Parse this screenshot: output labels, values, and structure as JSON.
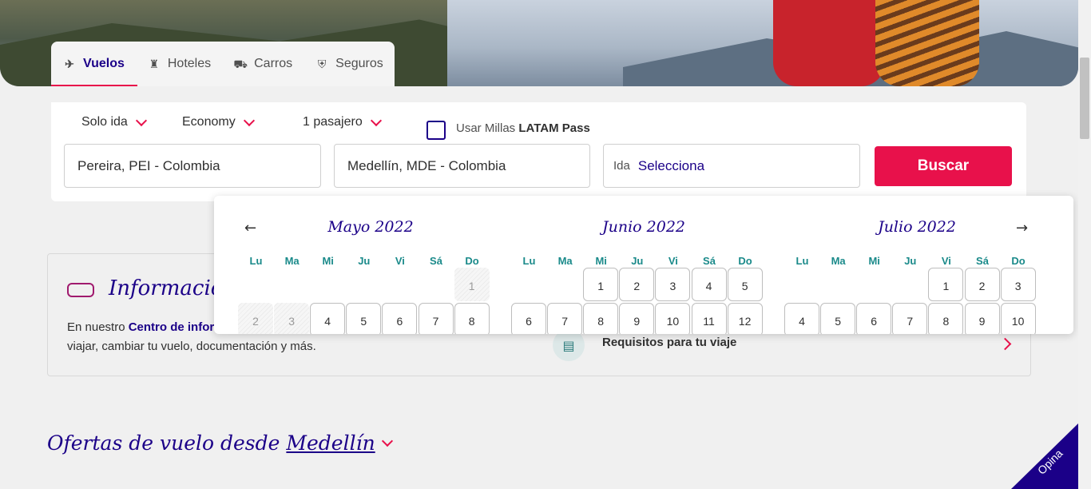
{
  "tabs": [
    {
      "label": "Vuelos",
      "icon": "plane-icon",
      "active": true
    },
    {
      "label": "Hoteles",
      "icon": "bellhop-icon",
      "active": false
    },
    {
      "label": "Carros",
      "icon": "car-icon",
      "active": false
    },
    {
      "label": "Seguros",
      "icon": "shield-icon",
      "active": false
    }
  ],
  "search": {
    "trip_type": "Solo ida",
    "cabin": "Economy",
    "passengers": "1 pasajero",
    "millas_prefix": "Usar Millas",
    "millas_brand": "LATAM Pass",
    "origin": "Pereira, PEI - Colombia",
    "destination": "Medellín, MDE - Colombia",
    "date_label": "Ida",
    "date_value": "Selecciona",
    "submit": "Buscar"
  },
  "calendar": {
    "prev_arrow": "←",
    "next_arrow": "→",
    "weekdays": [
      "Lu",
      "Ma",
      "Mi",
      "Ju",
      "Vi",
      "Sá",
      "Do"
    ],
    "months": [
      {
        "title": "Mayo 2022",
        "first_weekday_index": 6,
        "visible_days": [
          "1",
          "2",
          "3",
          "4",
          "5",
          "6",
          "7",
          "8"
        ],
        "past_days": [
          "1",
          "2",
          "3"
        ]
      },
      {
        "title": "Junio 2022",
        "first_weekday_index": 2,
        "visible_days": [
          "1",
          "2",
          "3",
          "4",
          "5",
          "6",
          "7",
          "8",
          "9",
          "10",
          "11",
          "12"
        ],
        "past_days": []
      },
      {
        "title": "Julio 2022",
        "first_weekday_index": 4,
        "visible_days": [
          "1",
          "2",
          "3",
          "4",
          "5",
          "6",
          "7",
          "8",
          "9",
          "10"
        ],
        "past_days": []
      }
    ]
  },
  "info": {
    "title": "Información",
    "text_prefix": "En nuestro",
    "link_text": "Centro de infor",
    "text_line2": "viajar, cambiar tu vuelo, documentación y más.",
    "requirements": "Requisitos para tu viaje"
  },
  "offers": {
    "prefix": "Ofertas de vuelo desde",
    "city": "Medellín"
  },
  "feedback": {
    "label": "Opina"
  },
  "colors": {
    "brand_blue": "#1b0088",
    "accent_red": "#e8114b",
    "weekday_teal": "#1a8a8a"
  }
}
